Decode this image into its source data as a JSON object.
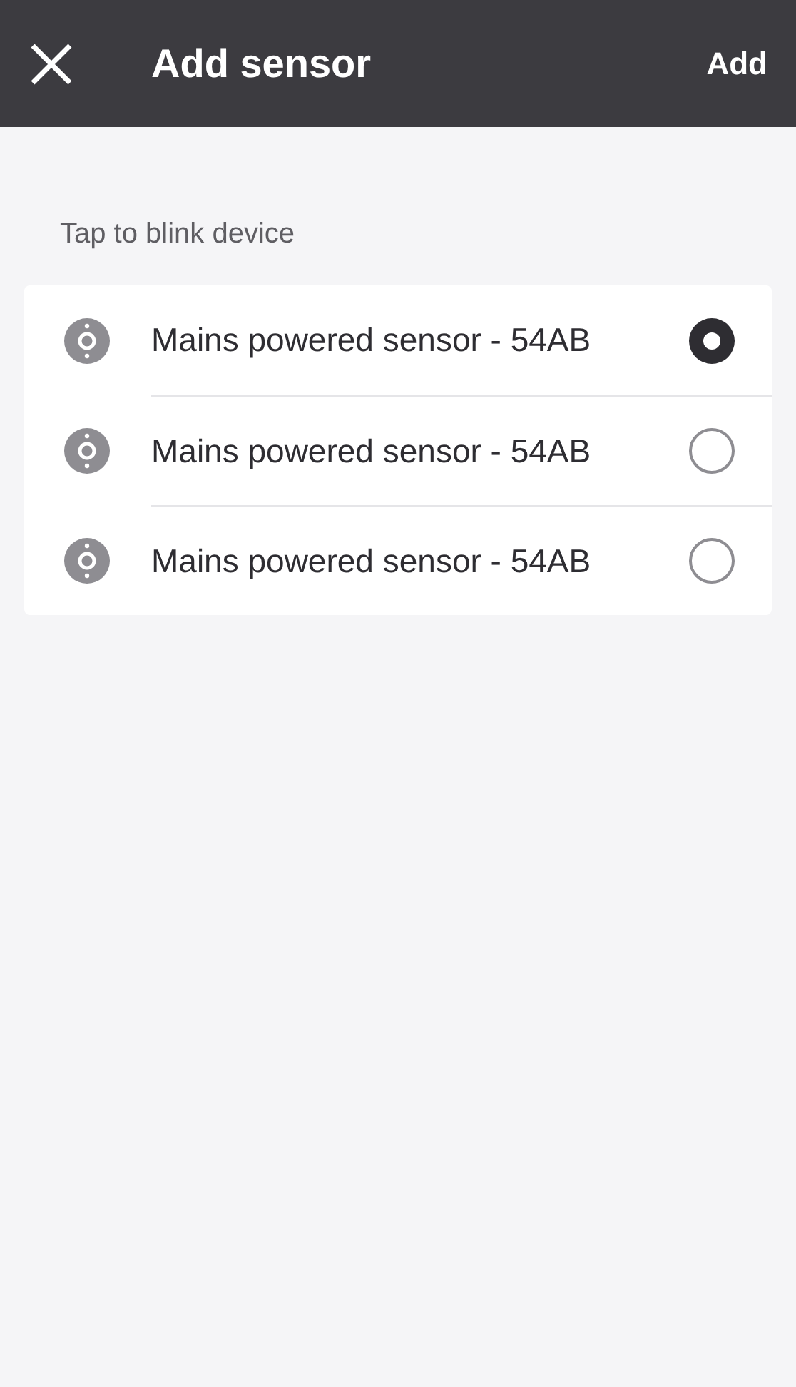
{
  "header": {
    "title": "Add sensor",
    "action": "Add"
  },
  "section_label": "Tap to blink device",
  "sensors": [
    {
      "name": "Mains powered sensor - 54AB",
      "selected": true
    },
    {
      "name": "Mains powered sensor - 54AB",
      "selected": false
    },
    {
      "name": "Mains powered sensor - 54AB",
      "selected": false
    }
  ]
}
